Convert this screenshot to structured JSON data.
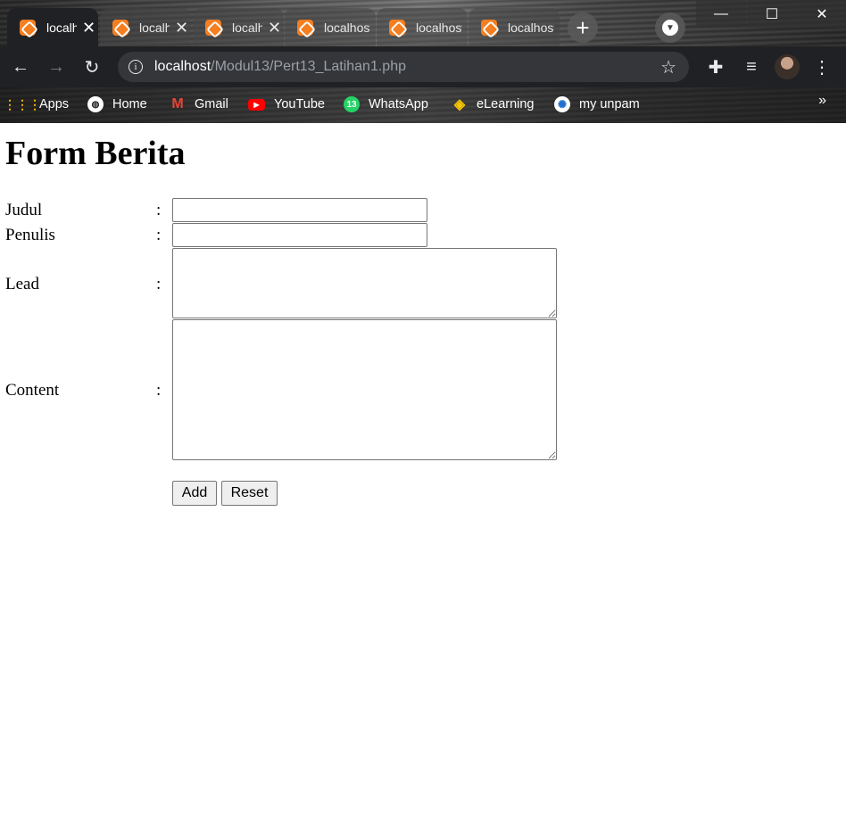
{
  "browser": {
    "tabs": [
      {
        "title": "localhost",
        "active": true
      },
      {
        "title": "localhost",
        "active": false
      },
      {
        "title": "localhost",
        "active": false
      },
      {
        "title": "localhost",
        "active": false
      },
      {
        "title": "localhost",
        "active": false
      },
      {
        "title": "localhost",
        "active": false
      }
    ],
    "url_host": "localhost",
    "url_path": "/Modul13/Pert13_Latihan1.php",
    "bookmarks": [
      "Apps",
      "Home",
      "Gmail",
      "YouTube",
      "WhatsApp",
      "eLearning",
      "my unpam"
    ],
    "whatsapp_badge": "13",
    "more_bookmarks": "»",
    "icons": {
      "back": "arrow-left-icon",
      "forward": "arrow-right-icon",
      "reload": "reload-icon",
      "info": "info-icon",
      "star": "star-icon",
      "extensions": "puzzle-icon",
      "media": "playlist-icon",
      "menu": "kebab-menu-icon"
    }
  },
  "page": {
    "title": "Form Berita",
    "colon": ":",
    "fields": {
      "judul": {
        "label": "Judul",
        "value": ""
      },
      "penulis": {
        "label": "Penulis",
        "value": ""
      },
      "lead": {
        "label": "Lead",
        "value": ""
      },
      "content": {
        "label": "Content",
        "value": ""
      }
    },
    "buttons": {
      "add": "Add",
      "reset": "Reset"
    }
  }
}
